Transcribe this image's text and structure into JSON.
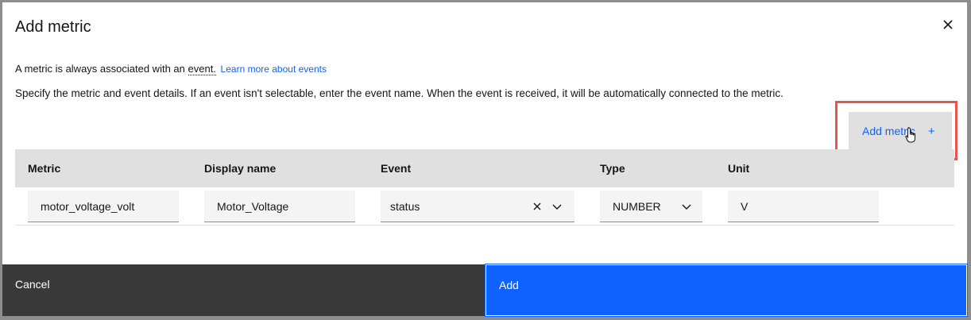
{
  "modal": {
    "title": "Add metric",
    "desc_prefix": "A metric is always associated with an",
    "desc_term": "event.",
    "learn_more_link": "Learn more about events",
    "desc_details": "Specify the metric and event details. If an event isn't selectable, enter the event name. When the event is received, it will be automatically connected to the metric."
  },
  "add_metric_button": {
    "label": "Add metric",
    "icon": "plus-icon"
  },
  "table": {
    "headers": [
      "Metric",
      "Display name",
      "Event",
      "Type",
      "Unit"
    ],
    "row": {
      "metric": "motor_voltage_volt",
      "display_name": "Motor_Voltage",
      "event": "status",
      "type": "NUMBER",
      "unit": "V"
    }
  },
  "footer": {
    "cancel_label": "Cancel",
    "add_label": "Add"
  },
  "colors": {
    "primary": "#0f62fe",
    "secondary": "#393939",
    "highlight": "#e8554e"
  }
}
